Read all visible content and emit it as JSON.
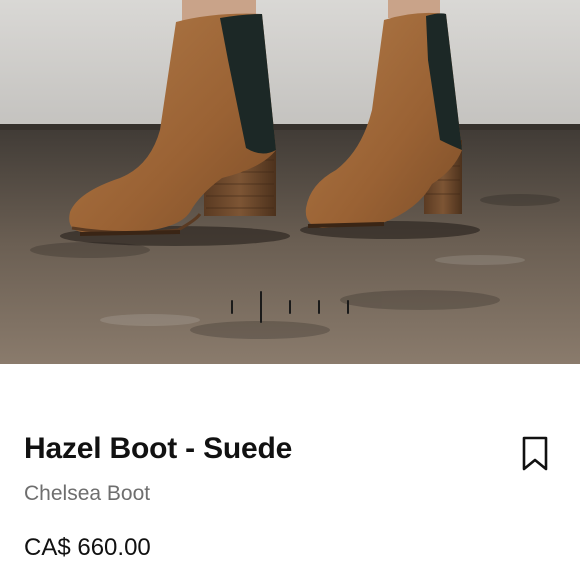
{
  "product": {
    "name": "Hazel Boot - Suede",
    "category": "Chelsea Boot",
    "price": "CA$ 660.00"
  },
  "carousel": {
    "slide_count": 5,
    "active_index": 1
  },
  "icons": {
    "save": "bookmark-icon"
  },
  "colors": {
    "text_primary": "#111111",
    "text_secondary": "#6e6e6e",
    "suede": "#a0693a"
  }
}
